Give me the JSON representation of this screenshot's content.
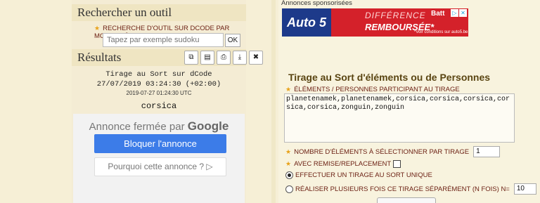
{
  "left": {
    "search_tool_heading": "Rechercher un outil",
    "search_label": "RECHERCHE D'OUTIL SUR DCODE PAR MOTS-CLÉS :",
    "search_placeholder": "Tapez par exemple sudoku",
    "ok_label": "OK",
    "results_heading": "Résultats",
    "tool_buttons": [
      {
        "icon": "copy-icon",
        "glyph": "⧉"
      },
      {
        "icon": "save-icon",
        "glyph": "▤"
      },
      {
        "icon": "print-icon",
        "glyph": "⎙"
      },
      {
        "icon": "download-icon",
        "glyph": "⤓"
      },
      {
        "icon": "close-icon",
        "glyph": "✖"
      }
    ],
    "result_title": "Tirage au Sort sur dCode",
    "result_date": "27/07/2019 03:24:30 (+02:00)",
    "result_utc": "2019-07-27 01:24:30 UTC",
    "result_word": "corsica",
    "ad": {
      "closed_text": "Annonce fermée par",
      "google": "Google",
      "block_label": "Bloquer l'annonce",
      "why_label": "Pourquoi cette annonce ? ▷"
    }
  },
  "right": {
    "sponsored_label": "Annonces sponsorisées",
    "banner": {
      "brand": "Auto 5",
      "line1": "DIFFÉRENCE",
      "line2": "REMBOURSÉE*",
      "partner": "Batt",
      "fine_print": "*Voir conditions sur auto5.be"
    },
    "title": "Tirage au Sort d'éléments ou de Personnes",
    "elements_label": "ÉLÉMENTS / PERSONNES PARTICIPANT AU TIRAGE",
    "elements_value": "planetenamek,planetenamek,corsica,corsica,corsica,corsica,corsica,zonguin,zonguin",
    "count_label": "NOMBRE D'ÉLÉMENTS À SÉLECTIONNER PAR TIRAGE",
    "count_value": "1",
    "replace_label": "AVEC REMISE/REPLACEMENT",
    "single_label": "EFFECTUER UN TIRAGE AU SORT UNIQUE",
    "multi_label": "RÉALISER PLUSIEURS FOIS CE TIRAGE SÉPARÉMENT (N FOIS) N=",
    "multi_value": "10"
  }
}
